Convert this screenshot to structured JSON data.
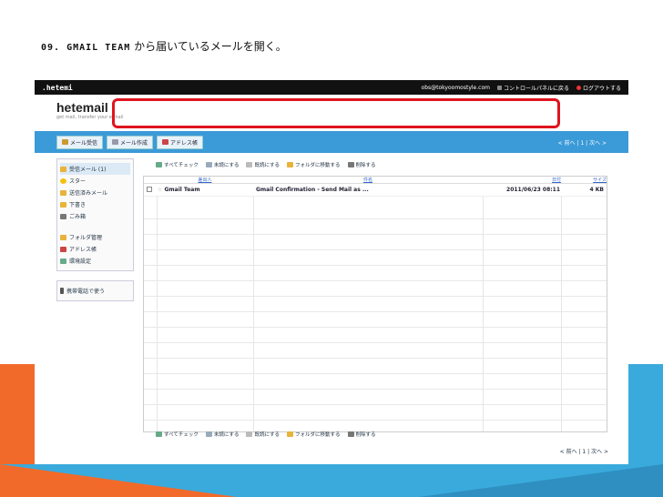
{
  "slide": {
    "title_caps": "09. GMAIL TEAM",
    "title_rest": " から届いているメールを開く。"
  },
  "topbar": {
    "logo": ".hetemi",
    "email": "obs@tokyoomostyle.com",
    "control_panel": "コントロールパネルに戻る",
    "logout": "ログアウトする"
  },
  "brand": {
    "name": "hetemail",
    "tagline": "get mail, transfer your e-mail"
  },
  "nav": {
    "inbox_button": "メール受信",
    "compose_button": "メール作成",
    "address_button": "アドレス帳",
    "pager": "< 前へ | 1 | 次へ >"
  },
  "sidebar": {
    "items": [
      {
        "label": "受信メール (1)"
      },
      {
        "label": "スター"
      },
      {
        "label": "送信済みメール"
      },
      {
        "label": "下書き"
      },
      {
        "label": "ごみ箱"
      }
    ],
    "items2": [
      {
        "label": "フォルダ管理"
      },
      {
        "label": "アドレス帳"
      },
      {
        "label": "環境設定"
      }
    ],
    "mobile": "携帯電話で使う"
  },
  "toolbar": {
    "check_all": "すべてチェック",
    "mark_unread": "未読にする",
    "mark_read": "既読にする",
    "move_folder": "フォルダに移動する",
    "delete": "削除する"
  },
  "table": {
    "headers": [
      "差出人",
      "件名",
      "日付",
      "サイズ"
    ],
    "rows": [
      {
        "from": "Gmail Team",
        "subject": "Gmail Confirmation - Send Mail as ...",
        "date": "2011/06/23 08:11",
        "size": "4 KB"
      }
    ]
  },
  "pager_bottom": "< 前へ | 1 | 次へ >",
  "colors": {
    "nav": "#3b9ad8",
    "highlight": "#e0141e",
    "orange": "#f26a2a",
    "blue": "#3aaadc"
  }
}
